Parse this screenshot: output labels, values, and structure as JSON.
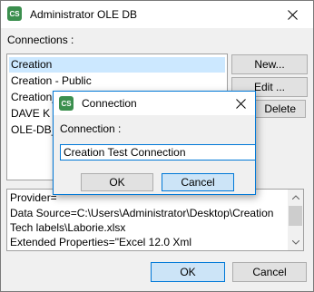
{
  "window": {
    "title": "Administrator OLE DB",
    "icon_text": "CS",
    "icon_color": "#3b8f4e"
  },
  "connections_label": "Connections :",
  "connections_list": [
    {
      "label": "Creation",
      "selected": true
    },
    {
      "label": "Creation - Public",
      "selected": false
    },
    {
      "label": "Creation_",
      "selected": false
    },
    {
      "label": "DAVE K",
      "selected": false
    },
    {
      "label": "OLE-DB_T",
      "selected": false
    }
  ],
  "side_buttons": {
    "new": "New...",
    "edit": "Edit ...",
    "delete": "Delete"
  },
  "details": {
    "lines": [
      "Provider=",
      "Data Source=C:\\Users\\Administrator\\Desktop\\Creation",
      "Tech labels\\Laborie.xlsx",
      "Extended Properties=\"Excel 12.0 Xml"
    ]
  },
  "footer": {
    "ok": "OK",
    "cancel": "Cancel"
  },
  "dialog": {
    "title": "Connection",
    "icon_text": "CS",
    "field_label": "Connection :",
    "field_value": "Creation Test Connection",
    "ok": "OK",
    "cancel": "Cancel"
  },
  "colors": {
    "accent": "#0078d7",
    "selection": "#cce8ff"
  }
}
